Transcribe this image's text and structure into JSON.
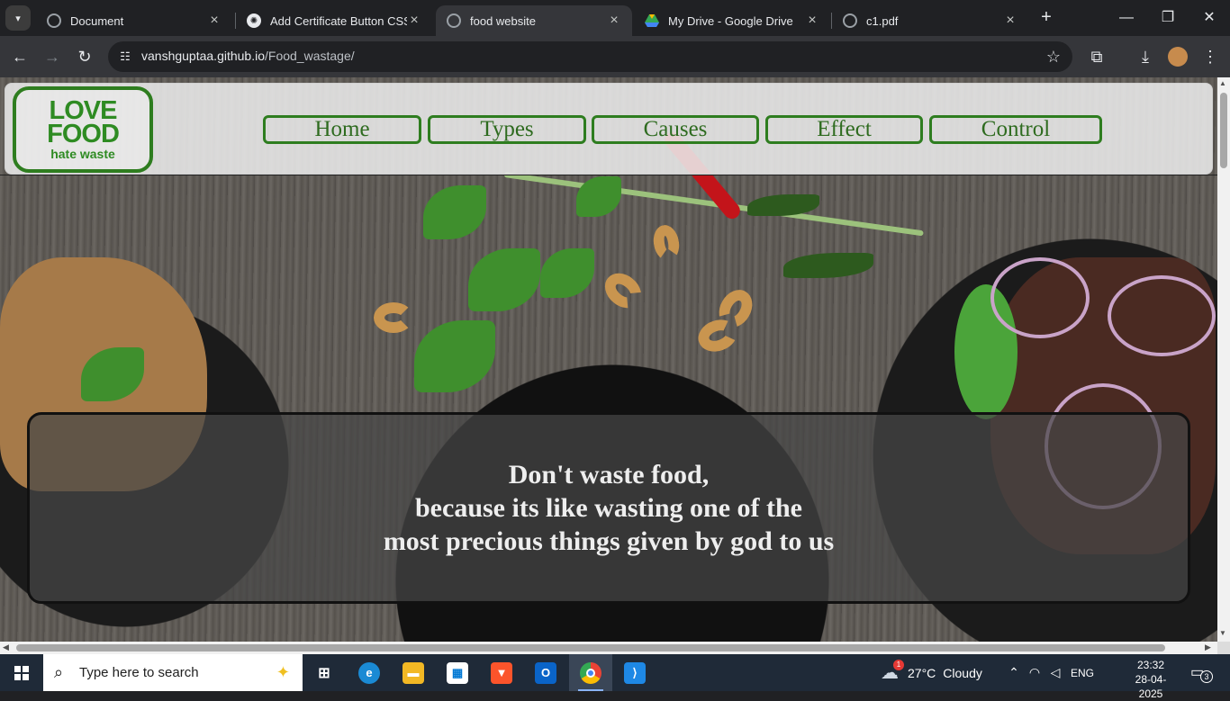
{
  "browser": {
    "tabs": [
      {
        "title": "Document",
        "icon": "globe-icon"
      },
      {
        "title": "Add Certificate Button CSS",
        "icon": "chatgpt-icon"
      },
      {
        "title": "food website",
        "icon": "globe-icon",
        "active": true
      },
      {
        "title": "My Drive - Google Drive",
        "icon": "google-drive-icon"
      },
      {
        "title": "c1.pdf",
        "icon": "globe-icon"
      }
    ],
    "url_host": "vanshguptaa.github.io",
    "url_path": "/Food_wastage/"
  },
  "site": {
    "logo": {
      "line1": "LOVE",
      "line2": "FOOD",
      "line3": "hate waste"
    },
    "nav": [
      "Home",
      "Types",
      "Causes",
      "Effect",
      "Control"
    ],
    "quote": [
      "Don't waste food,",
      "because its like wasting one of the",
      "most precious things given by god to us"
    ],
    "colors": {
      "accent_green": "#2e7d1f"
    }
  },
  "taskbar": {
    "search_placeholder": "Type here to search",
    "weather_temp": "27°C",
    "weather_desc": "Cloudy",
    "weather_badge": "1",
    "language": "ENG",
    "time": "23:32",
    "date": "28-04-2025",
    "notification_count": "3",
    "apps": [
      "task-view-icon",
      "edge-icon",
      "file-explorer-icon",
      "microsoft-store-icon",
      "brave-icon",
      "outlook-icon",
      "chrome-icon",
      "vscode-icon"
    ]
  }
}
